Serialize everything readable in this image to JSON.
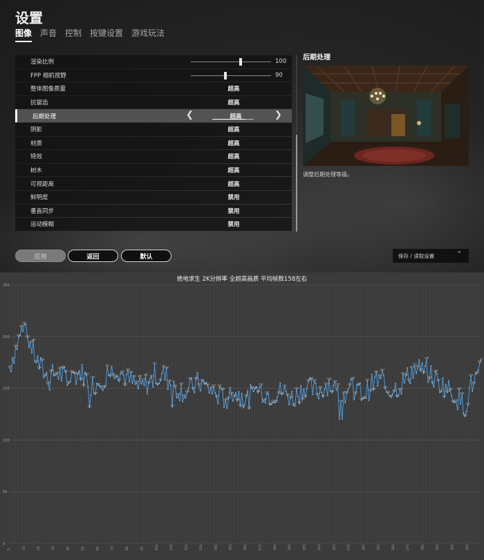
{
  "settings": {
    "title": "设置",
    "tabs": [
      "图像",
      "声音",
      "控制",
      "按键设置",
      "游戏玩法"
    ],
    "active_tab": 0,
    "rows": [
      {
        "label": "渲染比例",
        "type": "slider",
        "value": "100",
        "fraction": 0.62
      },
      {
        "label": "FPP 相机视野",
        "type": "slider",
        "value": "90",
        "fraction": 0.43
      },
      {
        "label": "整体图像质量",
        "type": "option",
        "value": "超高"
      },
      {
        "label": "抗锯齿",
        "type": "option",
        "value": "超高"
      },
      {
        "label": "后期处理",
        "type": "option",
        "value": "超高",
        "selected": true
      },
      {
        "label": "阴影",
        "type": "option",
        "value": "超高"
      },
      {
        "label": "材质",
        "type": "option",
        "value": "超高"
      },
      {
        "label": "特效",
        "type": "option",
        "value": "超高"
      },
      {
        "label": "树木",
        "type": "option",
        "value": "超高"
      },
      {
        "label": "可视距离",
        "type": "option",
        "value": "超高"
      },
      {
        "label": "鲜明度",
        "type": "option",
        "value": "禁用"
      },
      {
        "label": "垂直同步",
        "type": "option",
        "value": "禁用"
      },
      {
        "label": "运动模糊",
        "type": "option",
        "value": "禁用"
      }
    ],
    "preview": {
      "title": "后期处理",
      "description": "调整后期处理等级。"
    },
    "buttons": {
      "apply": "应用",
      "back": "返回",
      "default": "默认"
    },
    "save_load": "保存 / 读取设置",
    "icons": {
      "left": "chevron-left-icon",
      "right": "chevron-right-icon",
      "expand": "chevron-up-icon"
    }
  },
  "chart_data": {
    "type": "line",
    "title": "绝地求生 2K分辨率 全超高画质 平均帧数158左右",
    "ylim": [
      0,
      250
    ],
    "yticks": [
      0,
      50,
      100,
      150,
      200,
      250
    ],
    "grid": true,
    "series_color": "#4d9fe6",
    "n_points": 320,
    "x_tick_labels": [
      "1",
      "11",
      "21",
      "31",
      "41",
      "51",
      "61",
      "71",
      "81",
      "91",
      "101",
      "111",
      "121",
      "131",
      "141",
      "151",
      "161",
      "171",
      "181",
      "191",
      "201",
      "211",
      "221",
      "231",
      "241",
      "251",
      "261",
      "271",
      "281",
      "291",
      "301",
      "311"
    ],
    "anchors": [
      [
        0,
        170
      ],
      [
        4,
        188
      ],
      [
        8,
        205
      ],
      [
        12,
        200
      ],
      [
        16,
        185
      ],
      [
        20,
        172
      ],
      [
        26,
        160
      ],
      [
        32,
        165
      ],
      [
        40,
        158
      ],
      [
        48,
        166
      ],
      [
        56,
        152
      ],
      [
        64,
        160
      ],
      [
        72,
        170
      ],
      [
        80,
        158
      ],
      [
        88,
        150
      ],
      [
        96,
        157
      ],
      [
        104,
        163
      ],
      [
        112,
        150
      ],
      [
        120,
        146
      ],
      [
        128,
        156
      ],
      [
        136,
        148
      ],
      [
        144,
        140
      ],
      [
        152,
        146
      ],
      [
        160,
        138
      ],
      [
        168,
        150
      ],
      [
        176,
        143
      ],
      [
        184,
        147
      ],
      [
        192,
        140
      ],
      [
        200,
        152
      ],
      [
        208,
        146
      ],
      [
        216,
        155
      ],
      [
        224,
        141
      ],
      [
        232,
        150
      ],
      [
        240,
        144
      ],
      [
        248,
        158
      ],
      [
        256,
        148
      ],
      [
        264,
        152
      ],
      [
        272,
        166
      ],
      [
        280,
        170
      ],
      [
        288,
        158
      ],
      [
        296,
        150
      ],
      [
        302,
        142
      ],
      [
        308,
        132
      ],
      [
        312,
        152
      ],
      [
        316,
        160
      ],
      [
        319,
        168
      ]
    ]
  }
}
